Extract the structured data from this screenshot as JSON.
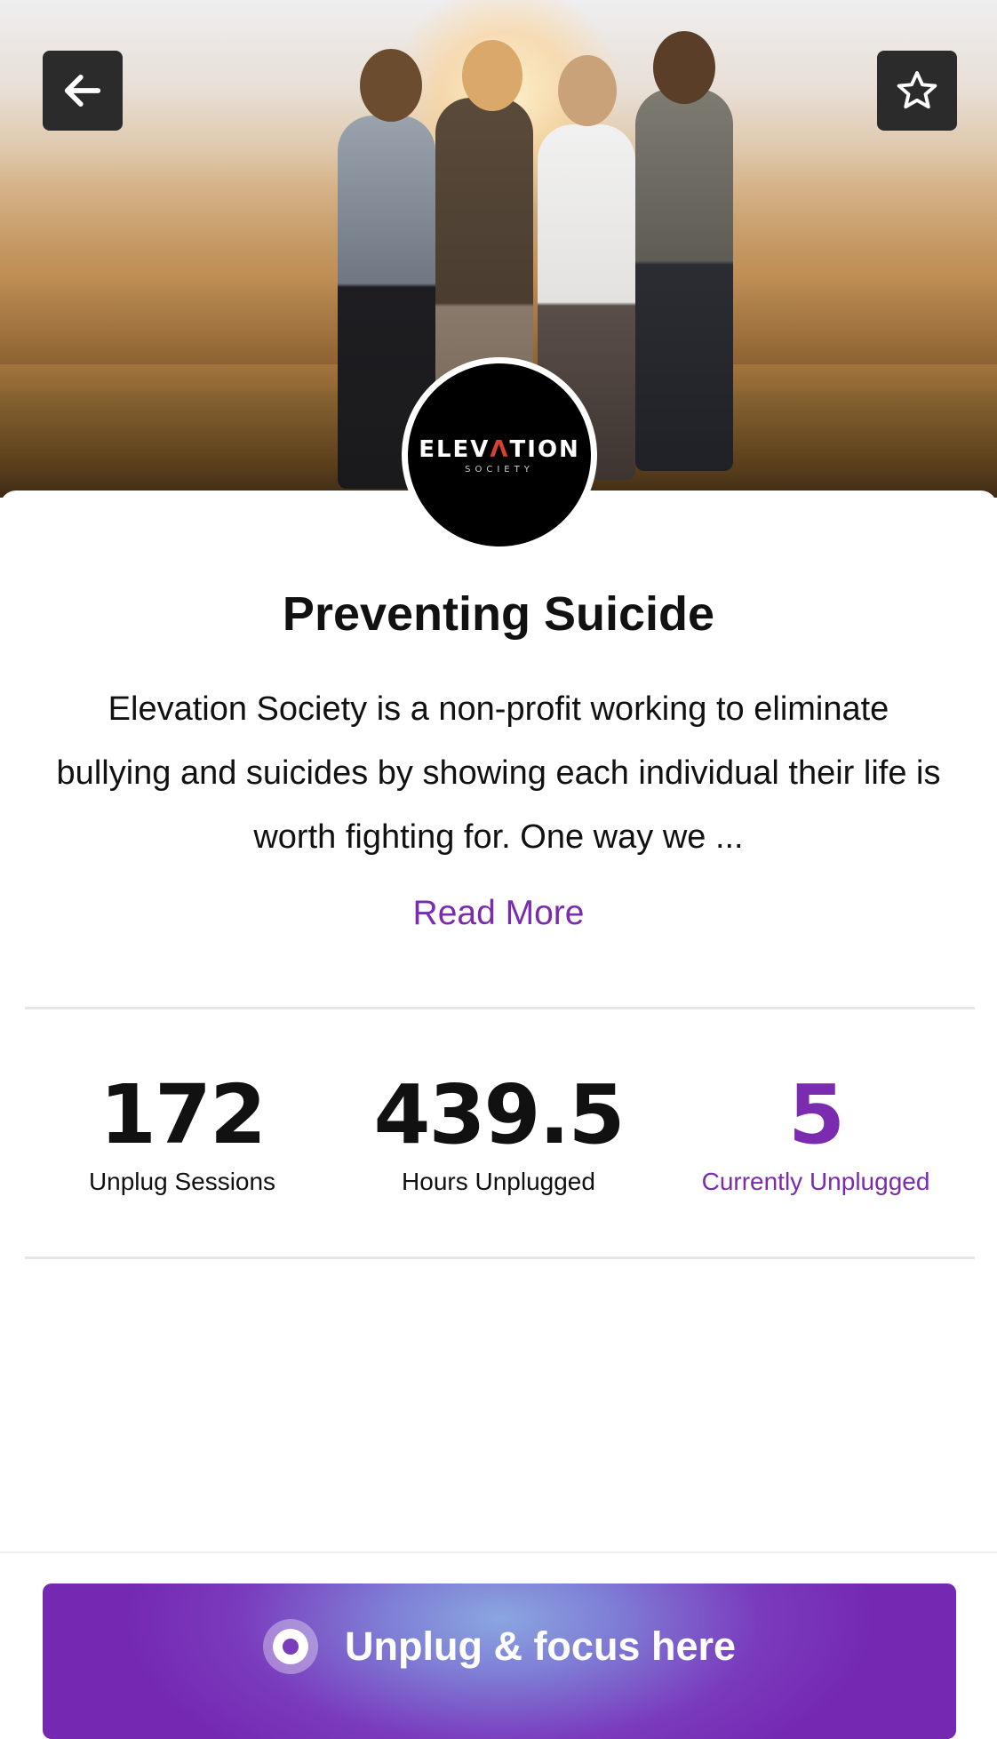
{
  "header": {
    "back_icon": "arrow-left-icon",
    "favorite_icon": "star-outline-icon"
  },
  "organization": {
    "logo_text_main_a": "ELEV",
    "logo_text_accent": "Λ",
    "logo_text_main_b": "TION",
    "logo_text_sub": "SOCIETY",
    "title": "Preventing Suicide",
    "description": "Elevation Society is a non-profit working to eliminate bullying and suicides by showing each individual their life is worth fighting for.  One way we ...",
    "read_more": "Read More"
  },
  "stats": [
    {
      "value": "172",
      "label": "Unplug Sessions"
    },
    {
      "value": "439.5",
      "label": "Hours Unplugged"
    },
    {
      "value": "5",
      "label": "Currently Unplugged"
    }
  ],
  "cta": {
    "label": "Unplug & focus here",
    "icon": "target-icon"
  },
  "colors": {
    "accent": "#7a2bb0",
    "button_dark": "#2b2b2b"
  }
}
